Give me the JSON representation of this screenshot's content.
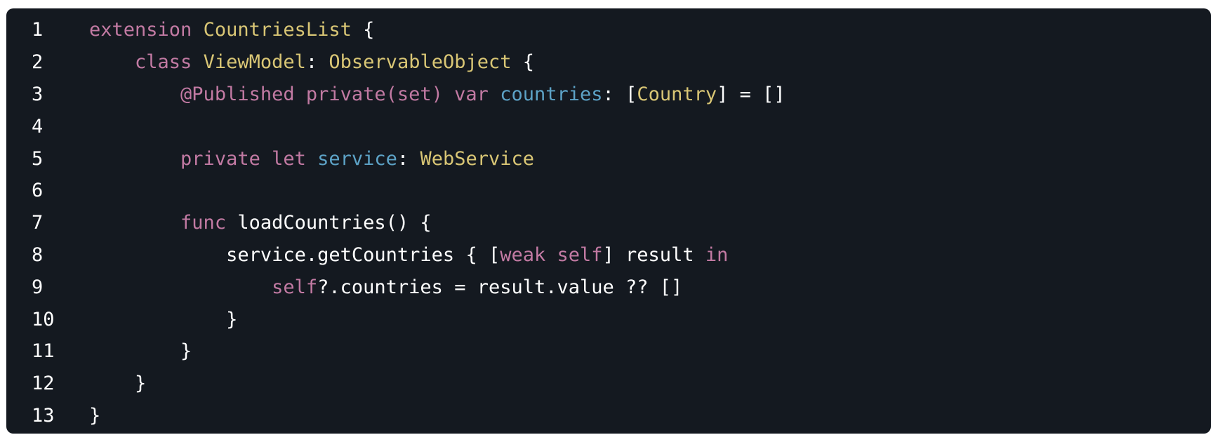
{
  "editor": {
    "colors": {
      "background": "#141920",
      "keyword": "#c27aa3",
      "type": "#d9c675",
      "property": "#5da3c7",
      "plain": "#ffffff"
    },
    "lines": [
      {
        "number": "1",
        "indent": "",
        "tokens": [
          {
            "t": "keyword",
            "v": "extension"
          },
          {
            "t": "plain",
            "v": " "
          },
          {
            "t": "type",
            "v": "CountriesList"
          },
          {
            "t": "plain",
            "v": " {"
          }
        ]
      },
      {
        "number": "2",
        "indent": "    ",
        "tokens": [
          {
            "t": "keyword",
            "v": "class"
          },
          {
            "t": "plain",
            "v": " "
          },
          {
            "t": "type",
            "v": "ViewModel"
          },
          {
            "t": "plain",
            "v": ": "
          },
          {
            "t": "type",
            "v": "ObservableObject"
          },
          {
            "t": "plain",
            "v": " {"
          }
        ]
      },
      {
        "number": "3",
        "indent": "        ",
        "tokens": [
          {
            "t": "keyword",
            "v": "@Published private(set) var"
          },
          {
            "t": "plain",
            "v": " "
          },
          {
            "t": "prop",
            "v": "countries"
          },
          {
            "t": "plain",
            "v": ": ["
          },
          {
            "t": "type",
            "v": "Country"
          },
          {
            "t": "plain",
            "v": "] = []"
          }
        ]
      },
      {
        "number": "4",
        "indent": "",
        "tokens": []
      },
      {
        "number": "5",
        "indent": "        ",
        "tokens": [
          {
            "t": "keyword",
            "v": "private let"
          },
          {
            "t": "plain",
            "v": " "
          },
          {
            "t": "prop",
            "v": "service"
          },
          {
            "t": "plain",
            "v": ": "
          },
          {
            "t": "type",
            "v": "WebService"
          }
        ]
      },
      {
        "number": "6",
        "indent": "",
        "tokens": []
      },
      {
        "number": "7",
        "indent": "        ",
        "tokens": [
          {
            "t": "keyword",
            "v": "func"
          },
          {
            "t": "plain",
            "v": " loadCountries() {"
          }
        ]
      },
      {
        "number": "8",
        "indent": "            ",
        "tokens": [
          {
            "t": "plain",
            "v": "service.getCountries { ["
          },
          {
            "t": "keyword",
            "v": "weak self"
          },
          {
            "t": "plain",
            "v": "] result "
          },
          {
            "t": "keyword",
            "v": "in"
          }
        ]
      },
      {
        "number": "9",
        "indent": "                ",
        "tokens": [
          {
            "t": "keyword",
            "v": "self"
          },
          {
            "t": "plain",
            "v": "?.countries = result.value ?? []"
          }
        ]
      },
      {
        "number": "10",
        "indent": "            ",
        "tokens": [
          {
            "t": "plain",
            "v": "}"
          }
        ]
      },
      {
        "number": "11",
        "indent": "        ",
        "tokens": [
          {
            "t": "plain",
            "v": "}"
          }
        ]
      },
      {
        "number": "12",
        "indent": "    ",
        "tokens": [
          {
            "t": "plain",
            "v": "}"
          }
        ]
      },
      {
        "number": "13",
        "indent": "",
        "tokens": [
          {
            "t": "plain",
            "v": "}"
          }
        ]
      }
    ]
  }
}
